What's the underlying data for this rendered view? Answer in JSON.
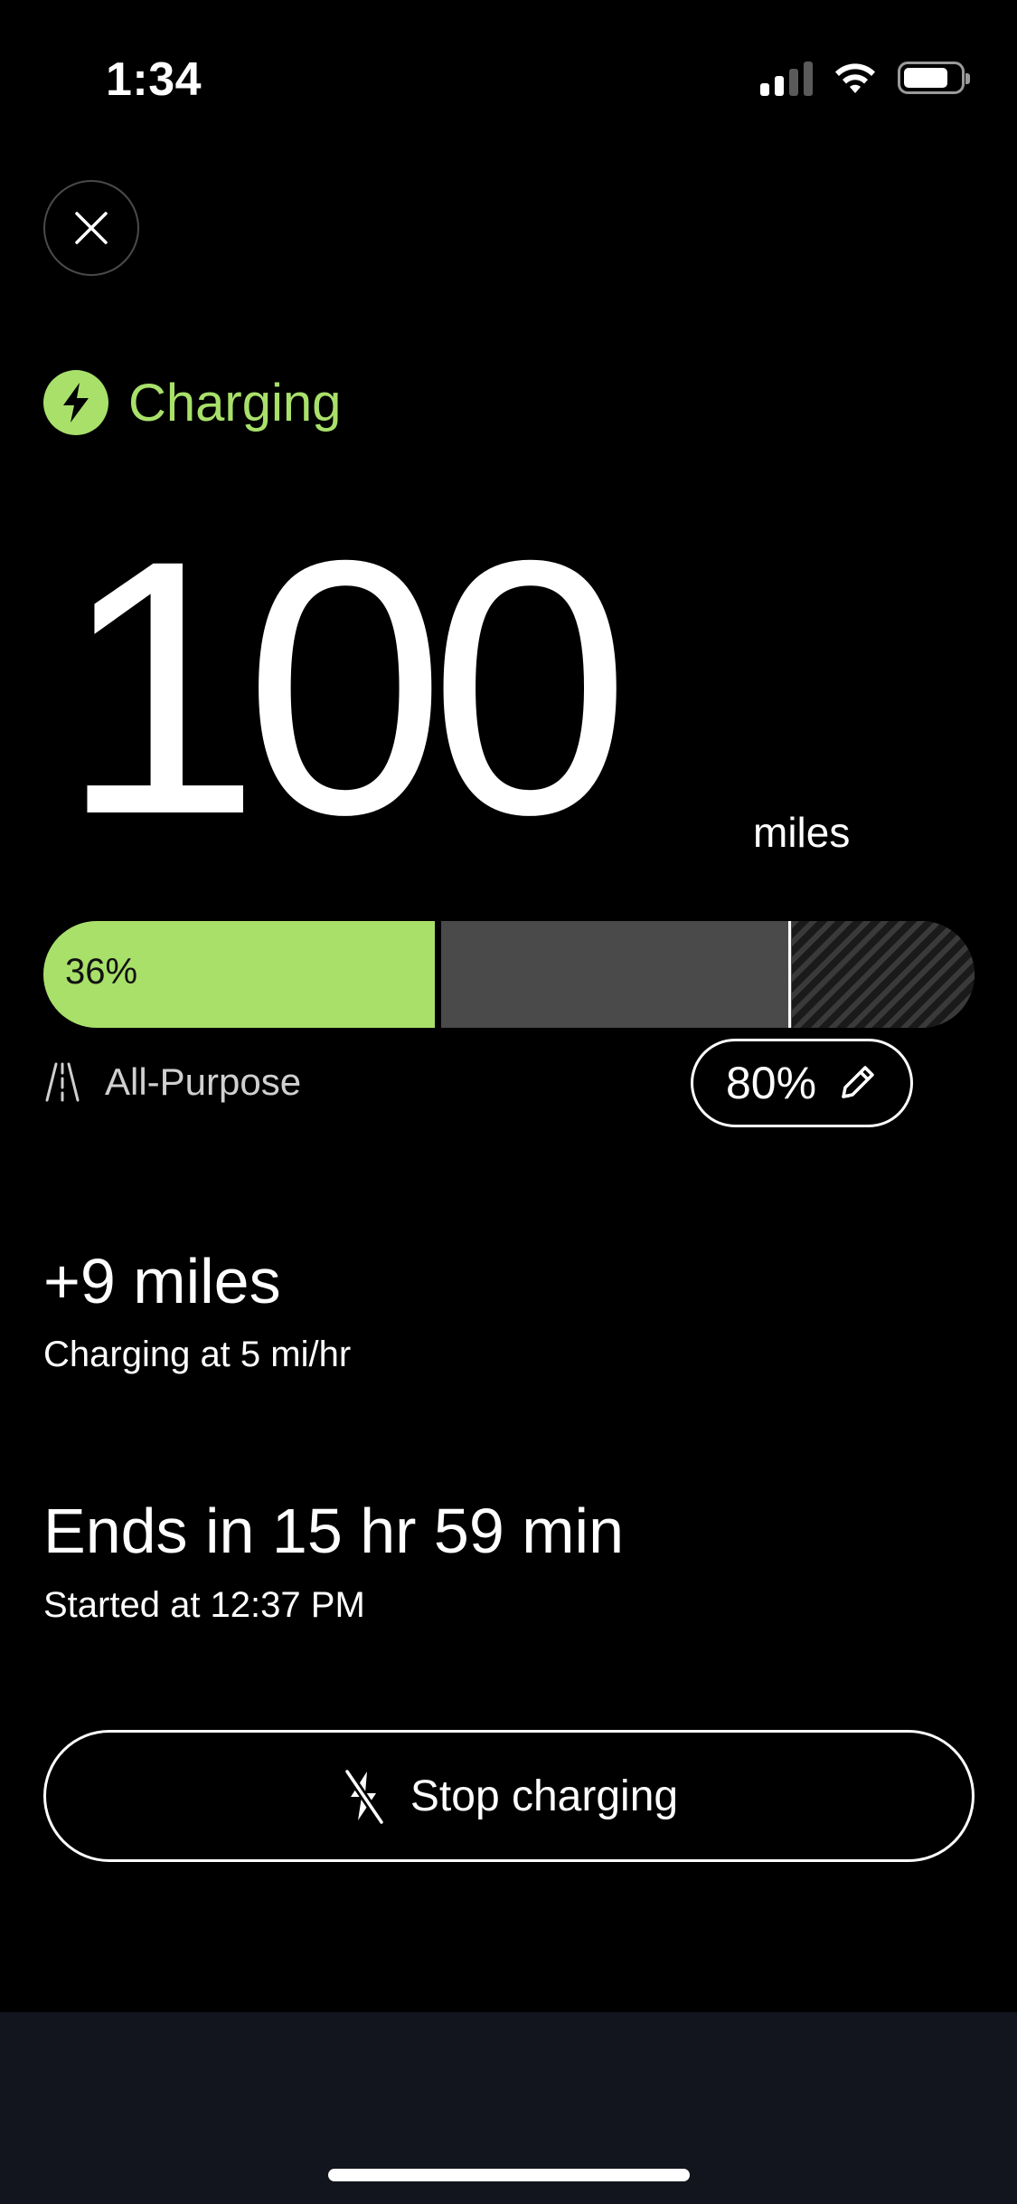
{
  "status_bar": {
    "time": "1:34"
  },
  "colors": {
    "accent": "#a8e06a",
    "background": "#000000",
    "bar_track": "#4a4a4a",
    "bottom_bar": "#12151d"
  },
  "header": {
    "close_icon": "close-icon"
  },
  "charging": {
    "status_label": "Charging",
    "icon": "lightning-bolt-icon"
  },
  "range": {
    "value": "100",
    "unit": "miles"
  },
  "battery": {
    "charge_label": "36%",
    "charge_level": 0.42,
    "limit_level": 0.8,
    "mode_icon": "road-icon",
    "mode_label": "All-Purpose",
    "limit_label": "80%",
    "edit_icon": "pencil-icon"
  },
  "added": {
    "title": "+9 miles",
    "subtitle": "Charging at 5 mi/hr"
  },
  "timing": {
    "title": "Ends in 15 hr 59 min",
    "subtitle": "Started at 12:37 PM"
  },
  "actions": {
    "stop_label": "Stop charging",
    "stop_icon": "no-charging-icon"
  }
}
